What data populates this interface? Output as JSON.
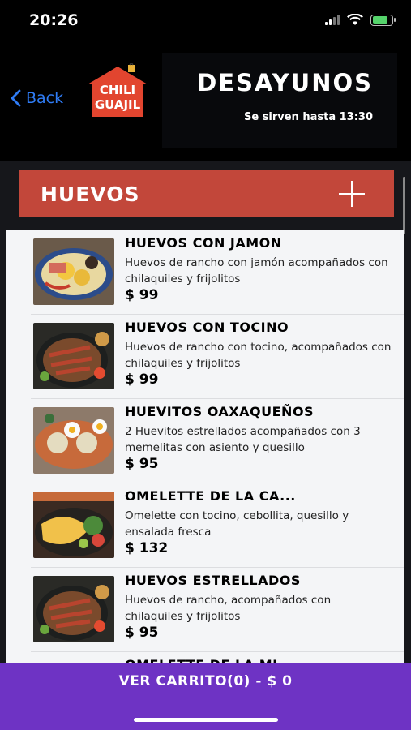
{
  "status_bar": {
    "time": "20:26",
    "battery_percent": 80
  },
  "header": {
    "back_label": "Back",
    "logo_text_line1": "CHILI",
    "logo_text_line2": "GUAJIL",
    "title": "DESAYUNOS",
    "subtitle": "Se sirven hasta 13:30"
  },
  "category": {
    "title": "HUEVOS",
    "expand_icon": "plus-icon"
  },
  "items": [
    {
      "name": "HUEVOS CON JAMON",
      "description": "Huevos de rancho con jamón acompañados con chilaquiles y frijolitos",
      "price": "$ 99"
    },
    {
      "name": "HUEVOS CON TOCINO",
      "description": "Huevos de rancho con tocino, acompañados con chilaquiles y frijolitos",
      "price": "$ 99"
    },
    {
      "name": "HUEVITOS OAXAQUEÑOS",
      "description": "2 Huevitos estrellados acompañados con 3 memelitas con asiento y quesillo",
      "price": "$ 95"
    },
    {
      "name": "OMELETTE DE LA CA...",
      "description": "Omelette con tocino, cebollita, quesillo y ensalada fresca",
      "price": "$ 132"
    },
    {
      "name": "HUEVOS ESTRELLADOS",
      "description": "Huevos de rancho, acompañados con chilaquiles y frijolitos",
      "price": "$ 95"
    },
    {
      "name": "OMELETTE DE LA MI...",
      "description": "",
      "price": ""
    }
  ],
  "cart": {
    "label": "VER CARRITO(0) - $ 0"
  },
  "colors": {
    "accent_red": "#c2473a",
    "cart_purple": "#6e33c4",
    "back_blue": "#2f7cf6"
  }
}
